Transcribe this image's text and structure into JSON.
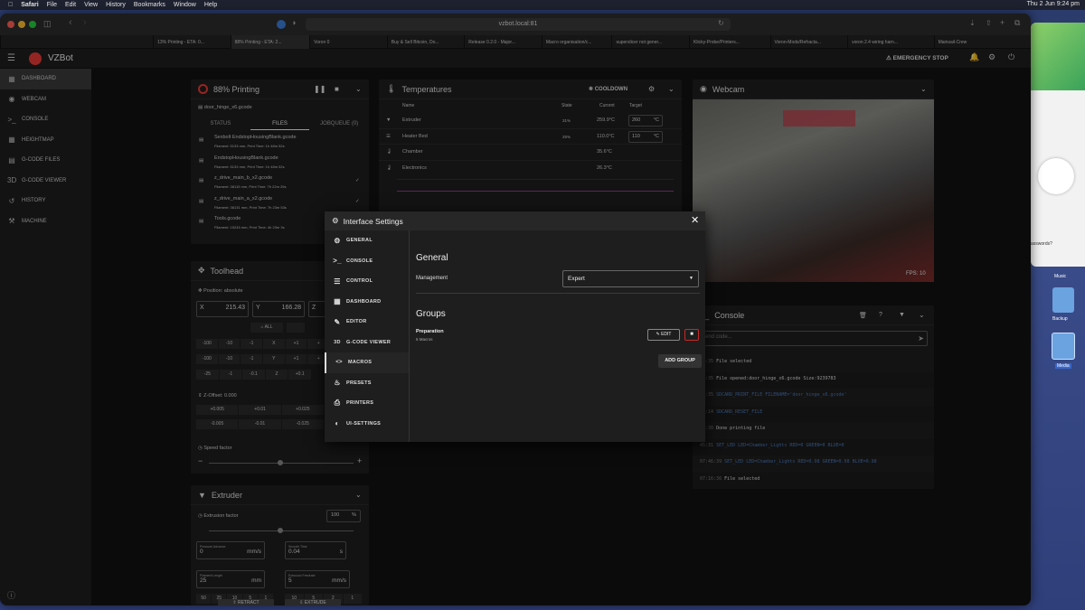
{
  "menubar": {
    "app": "Safari",
    "items": [
      "File",
      "Edit",
      "View",
      "History",
      "Bookmarks",
      "Window",
      "Help"
    ],
    "clock": "Thu 2 Jun  9:24 pm"
  },
  "browser": {
    "url": "vzbot.local:81",
    "tabs": [
      "13% Printing - ETA: 0...",
      "88% Printing - ETA: 2...",
      "Voron 0",
      "Buy & Sell Bitcoin, Do...",
      "Release 0.2.0 - Major...",
      "Macro organisation/c...",
      "superslicer not gener...",
      "Klicky-Probe/Printers...",
      "Voron-Mods/Refracta...",
      "voron 2.4 wiring harn...",
      "Mainsail-Crew"
    ]
  },
  "app": {
    "title": "VZBot",
    "emergency": "EMERGENCY STOP",
    "accent": "#e53935"
  },
  "nav": [
    {
      "label": "DASHBOARD",
      "icon": "dashboard-icon"
    },
    {
      "label": "WEBCAM",
      "icon": "webcam-icon"
    },
    {
      "label": "CONSOLE",
      "icon": "console-icon"
    },
    {
      "label": "HEIGHTMAP",
      "icon": "heightmap-icon"
    },
    {
      "label": "G-CODE FILES",
      "icon": "files-icon"
    },
    {
      "label": "G-CODE VIEWER",
      "icon": "viewer-icon"
    },
    {
      "label": "HISTORY",
      "icon": "history-icon"
    },
    {
      "label": "MACHINE",
      "icon": "machine-icon"
    }
  ],
  "printing": {
    "title": "88% Printing",
    "file": "door_hinge_x6.gcode",
    "tabs": [
      "STATUS",
      "FILES",
      "JOBQUEUE (0)"
    ],
    "files": [
      {
        "name": "Sexbolt EndstopHousingBlank.gcode",
        "meta": "Filament: 5133 mm, Print Time: 1h 48m 52s"
      },
      {
        "name": "EndstopHousingBlank.gcode",
        "meta": "Filament: 5133 mm, Print Time: 1h 48m 52s"
      },
      {
        "name": "z_drive_main_b_x2.gcode",
        "meta": "Filament: 38119 mm, Print Time: 7h 22m 29s"
      },
      {
        "name": "z_drive_main_a_x2.gcode",
        "meta": "Filament: 38131 mm, Print Time: 7h 23m 53s"
      },
      {
        "name": "Tools.gcode",
        "meta": "Filament: 15245 mm, Print Time: 4h 23m 3s"
      }
    ]
  },
  "toolhead": {
    "title": "Toolhead",
    "position": "Position: absolute",
    "x": "215.43",
    "y": "166.28",
    "all": "ALL",
    "xrow": [
      "-100",
      "-10",
      "-1",
      "X",
      "+1",
      "+"
    ],
    "yrow": [
      "-100",
      "-10",
      "-1",
      "Y",
      "+1",
      "+"
    ],
    "zrow": [
      "-25",
      "-1",
      "-0.1",
      "Z",
      "+0.1"
    ],
    "zoffset": "Z-Offset: 0.000",
    "zup": [
      "+0.005",
      "+0.01",
      "+0.025"
    ],
    "zdown": [
      "-0.005",
      "-0.01",
      "-0.025"
    ],
    "speed": "Speed factor"
  },
  "extruder": {
    "title": "Extruder",
    "factor_label": "Extrusion factor",
    "factor": "100",
    "pct": "%",
    "pa_label": "Pressure Advance",
    "pa": "0",
    "pa_unit": "mm/s",
    "st_label": "Smooth Time",
    "st": "0.04",
    "st_unit": "s",
    "fl_label": "Filament Length",
    "fl": "25",
    "fl_unit": "mm",
    "fr_label": "Extrusion Feedrate",
    "fr": "5",
    "fr_unit": "mm/s",
    "lens": [
      "50",
      "25",
      "10",
      "5",
      "1"
    ],
    "rates": [
      "10",
      "5",
      "2",
      "1"
    ],
    "retract": "RETRACT",
    "extrude": "EXTRUDE"
  },
  "temps": {
    "title": "Temperatures",
    "cooldown": "COOLDOWN",
    "cols": [
      "Name",
      "State",
      "Current",
      "Target"
    ],
    "rows": [
      {
        "name": "Extruder",
        "state": "31%",
        "current": "259.9°C",
        "target": "260",
        "unit": "°C"
      },
      {
        "name": "Heater Bed",
        "state": "25%",
        "current": "110.0°C",
        "target": "110",
        "unit": "°C"
      },
      {
        "name": "Chamber",
        "state": "",
        "current": "35.6°C",
        "target": "",
        "unit": ""
      },
      {
        "name": "Electronics",
        "state": "",
        "current": "26.3°C",
        "target": "",
        "unit": ""
      }
    ]
  },
  "webcam": {
    "title": "Webcam",
    "fps": "FPS: 10"
  },
  "console": {
    "title": "Console",
    "placeholder": "Send code...",
    "lines": [
      {
        "t": "05:35",
        "m": "File selected",
        "blue": false
      },
      {
        "t": "05:35",
        "m": "File opened:door_hinge_x6.gcode Size:9239783",
        "blue": false
      },
      {
        "t": "05:35",
        "m": "SDCARD_PRINT_FILE FILENAME='door_hinge_x6.gcode'",
        "blue": true
      },
      {
        "t": "04:14",
        "m": "SDCARD_RESET_FILE",
        "blue": true
      },
      {
        "t": "48:30",
        "m": "Done printing file",
        "blue": false
      },
      {
        "t": "45:31",
        "m": "SET_LED LED=Chamber_Lights RED=0 GREEN=0 BLUE=0",
        "blue": true
      },
      {
        "t": "07:46:39",
        "m": "SET_LED LED=Chamber_Lights RED=0.98 GREEN=0.98 BLUE=0.98",
        "blue": true
      },
      {
        "t": "07:16:36",
        "m": "File selected",
        "blue": false
      }
    ]
  },
  "dialog": {
    "title": "Interface Settings",
    "nav": [
      {
        "label": "GENERAL",
        "icon": "gear-icon"
      },
      {
        "label": "CONSOLE",
        "icon": "console-icon"
      },
      {
        "label": "CONTROL",
        "icon": "control-icon"
      },
      {
        "label": "DASHBOARD",
        "icon": "dashboard-icon"
      },
      {
        "label": "EDITOR",
        "icon": "editor-icon"
      },
      {
        "label": "G-CODE VIEWER",
        "icon": "3d-icon"
      },
      {
        "label": "MACROS",
        "icon": "code-icon"
      },
      {
        "label": "PRESETS",
        "icon": "fire-icon"
      },
      {
        "label": "PRINTERS",
        "icon": "printer-icon"
      },
      {
        "label": "UI-SETTINGS",
        "icon": "palette-icon"
      }
    ],
    "section": "General",
    "management_label": "Management",
    "management_value": "Expert",
    "groups": "Groups",
    "group_name": "Preparation",
    "group_sub": "5 Macros",
    "edit": "EDIT",
    "add": "ADD GROUP"
  },
  "desktop": {
    "music": "Music",
    "backup": "Backup",
    "media": "Media",
    "hint": "asswords?"
  }
}
